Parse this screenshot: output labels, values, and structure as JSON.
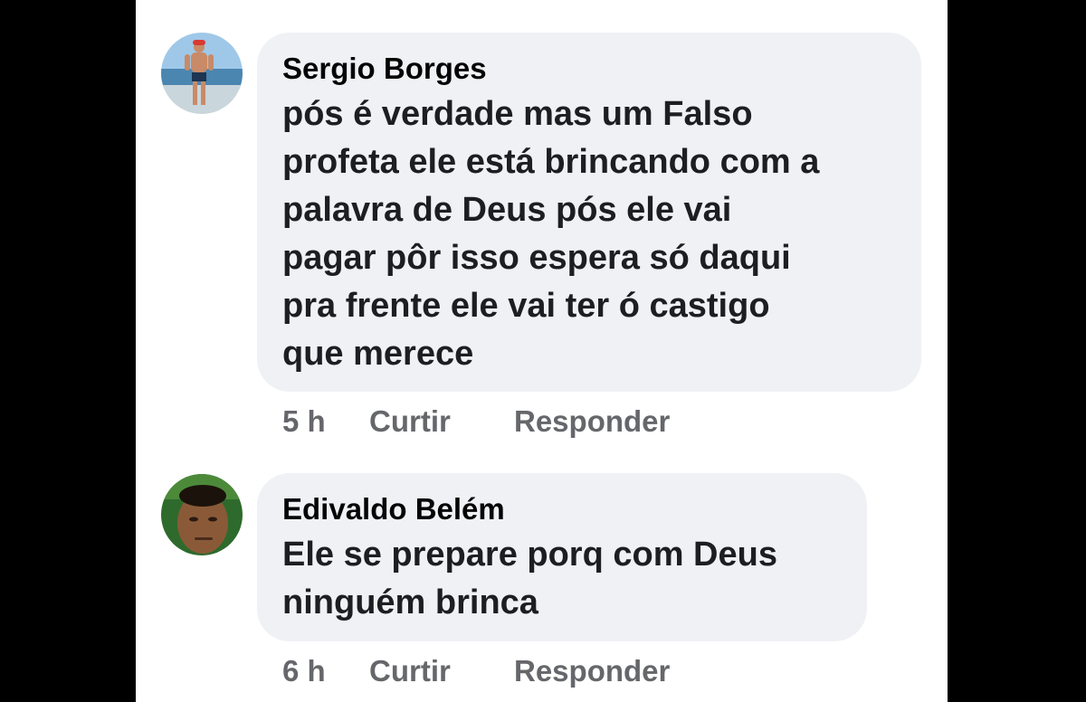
{
  "colors": {
    "page_background": "#000000",
    "panel_background": "#ffffff",
    "bubble_background": "#f0f1f5",
    "author_text": "#050505",
    "comment_text": "#1c1e21",
    "meta_text": "#65676b"
  },
  "comments": [
    {
      "author": "Sergio Borges",
      "avatar": "profile-photo-beach",
      "lines": [
        "pós é verdade mas um Falso",
        "profeta ele está brincando com a",
        "palavra de Deus pós ele vai",
        "pagar pôr isso espera só daqui",
        "pra frente ele vai ter ó castigo",
        "que merece"
      ],
      "time": "5 h",
      "like_label": "Curtir",
      "reply_label": "Responder"
    },
    {
      "author": "Edivaldo Belém",
      "avatar": "profile-photo-portrait",
      "lines": [
        "Ele se prepare porq com Deus",
        "ninguém brinca"
      ],
      "time": "6 h",
      "like_label": "Curtir",
      "reply_label": "Responder"
    }
  ]
}
